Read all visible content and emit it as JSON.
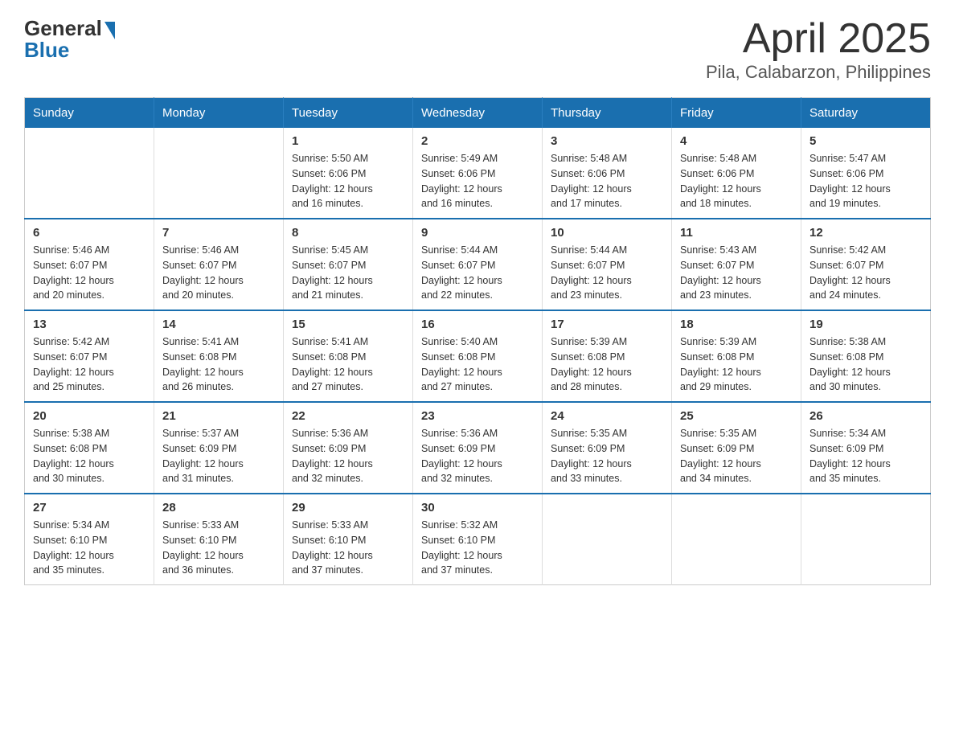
{
  "header": {
    "title": "April 2025",
    "subtitle": "Pila, Calabarzon, Philippines",
    "logo": {
      "general": "General",
      "blue": "Blue"
    }
  },
  "calendar": {
    "days_of_week": [
      "Sunday",
      "Monday",
      "Tuesday",
      "Wednesday",
      "Thursday",
      "Friday",
      "Saturday"
    ],
    "weeks": [
      [
        {
          "date": "",
          "info": ""
        },
        {
          "date": "",
          "info": ""
        },
        {
          "date": "1",
          "info": "Sunrise: 5:50 AM\nSunset: 6:06 PM\nDaylight: 12 hours\nand 16 minutes."
        },
        {
          "date": "2",
          "info": "Sunrise: 5:49 AM\nSunset: 6:06 PM\nDaylight: 12 hours\nand 16 minutes."
        },
        {
          "date": "3",
          "info": "Sunrise: 5:48 AM\nSunset: 6:06 PM\nDaylight: 12 hours\nand 17 minutes."
        },
        {
          "date": "4",
          "info": "Sunrise: 5:48 AM\nSunset: 6:06 PM\nDaylight: 12 hours\nand 18 minutes."
        },
        {
          "date": "5",
          "info": "Sunrise: 5:47 AM\nSunset: 6:06 PM\nDaylight: 12 hours\nand 19 minutes."
        }
      ],
      [
        {
          "date": "6",
          "info": "Sunrise: 5:46 AM\nSunset: 6:07 PM\nDaylight: 12 hours\nand 20 minutes."
        },
        {
          "date": "7",
          "info": "Sunrise: 5:46 AM\nSunset: 6:07 PM\nDaylight: 12 hours\nand 20 minutes."
        },
        {
          "date": "8",
          "info": "Sunrise: 5:45 AM\nSunset: 6:07 PM\nDaylight: 12 hours\nand 21 minutes."
        },
        {
          "date": "9",
          "info": "Sunrise: 5:44 AM\nSunset: 6:07 PM\nDaylight: 12 hours\nand 22 minutes."
        },
        {
          "date": "10",
          "info": "Sunrise: 5:44 AM\nSunset: 6:07 PM\nDaylight: 12 hours\nand 23 minutes."
        },
        {
          "date": "11",
          "info": "Sunrise: 5:43 AM\nSunset: 6:07 PM\nDaylight: 12 hours\nand 23 minutes."
        },
        {
          "date": "12",
          "info": "Sunrise: 5:42 AM\nSunset: 6:07 PM\nDaylight: 12 hours\nand 24 minutes."
        }
      ],
      [
        {
          "date": "13",
          "info": "Sunrise: 5:42 AM\nSunset: 6:07 PM\nDaylight: 12 hours\nand 25 minutes."
        },
        {
          "date": "14",
          "info": "Sunrise: 5:41 AM\nSunset: 6:08 PM\nDaylight: 12 hours\nand 26 minutes."
        },
        {
          "date": "15",
          "info": "Sunrise: 5:41 AM\nSunset: 6:08 PM\nDaylight: 12 hours\nand 27 minutes."
        },
        {
          "date": "16",
          "info": "Sunrise: 5:40 AM\nSunset: 6:08 PM\nDaylight: 12 hours\nand 27 minutes."
        },
        {
          "date": "17",
          "info": "Sunrise: 5:39 AM\nSunset: 6:08 PM\nDaylight: 12 hours\nand 28 minutes."
        },
        {
          "date": "18",
          "info": "Sunrise: 5:39 AM\nSunset: 6:08 PM\nDaylight: 12 hours\nand 29 minutes."
        },
        {
          "date": "19",
          "info": "Sunrise: 5:38 AM\nSunset: 6:08 PM\nDaylight: 12 hours\nand 30 minutes."
        }
      ],
      [
        {
          "date": "20",
          "info": "Sunrise: 5:38 AM\nSunset: 6:08 PM\nDaylight: 12 hours\nand 30 minutes."
        },
        {
          "date": "21",
          "info": "Sunrise: 5:37 AM\nSunset: 6:09 PM\nDaylight: 12 hours\nand 31 minutes."
        },
        {
          "date": "22",
          "info": "Sunrise: 5:36 AM\nSunset: 6:09 PM\nDaylight: 12 hours\nand 32 minutes."
        },
        {
          "date": "23",
          "info": "Sunrise: 5:36 AM\nSunset: 6:09 PM\nDaylight: 12 hours\nand 32 minutes."
        },
        {
          "date": "24",
          "info": "Sunrise: 5:35 AM\nSunset: 6:09 PM\nDaylight: 12 hours\nand 33 minutes."
        },
        {
          "date": "25",
          "info": "Sunrise: 5:35 AM\nSunset: 6:09 PM\nDaylight: 12 hours\nand 34 minutes."
        },
        {
          "date": "26",
          "info": "Sunrise: 5:34 AM\nSunset: 6:09 PM\nDaylight: 12 hours\nand 35 minutes."
        }
      ],
      [
        {
          "date": "27",
          "info": "Sunrise: 5:34 AM\nSunset: 6:10 PM\nDaylight: 12 hours\nand 35 minutes."
        },
        {
          "date": "28",
          "info": "Sunrise: 5:33 AM\nSunset: 6:10 PM\nDaylight: 12 hours\nand 36 minutes."
        },
        {
          "date": "29",
          "info": "Sunrise: 5:33 AM\nSunset: 6:10 PM\nDaylight: 12 hours\nand 37 minutes."
        },
        {
          "date": "30",
          "info": "Sunrise: 5:32 AM\nSunset: 6:10 PM\nDaylight: 12 hours\nand 37 minutes."
        },
        {
          "date": "",
          "info": ""
        },
        {
          "date": "",
          "info": ""
        },
        {
          "date": "",
          "info": ""
        }
      ]
    ]
  }
}
